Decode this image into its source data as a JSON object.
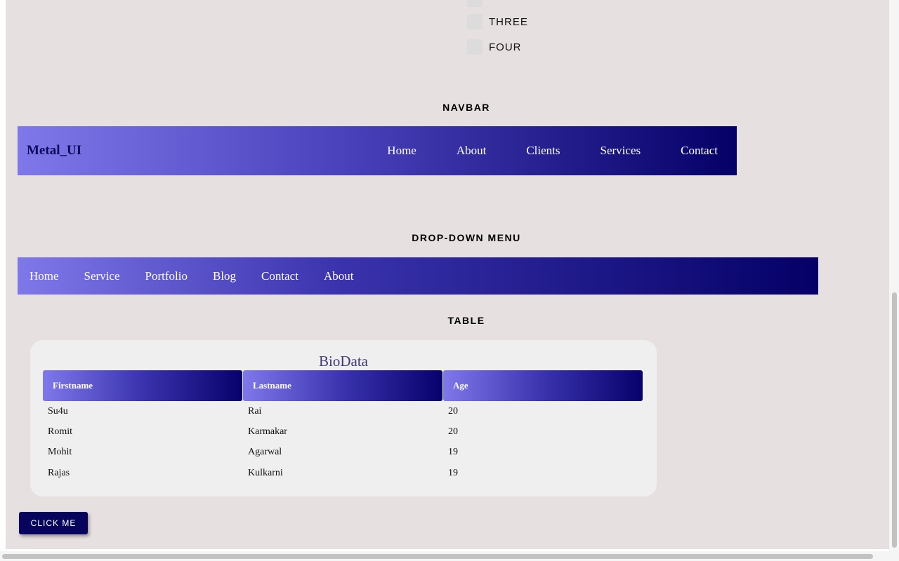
{
  "checklist": {
    "items": [
      "THREE",
      "FOUR"
    ]
  },
  "navbar_section": {
    "title": "NAVBAR",
    "brand": "Metal_UI",
    "links": [
      "Home",
      "About",
      "Clients",
      "Services",
      "Contact"
    ]
  },
  "dropdown_section": {
    "title": "DROP-DOWN MENU",
    "items": [
      "Home",
      "Service",
      "Portfolio",
      "Blog",
      "Contact",
      "About"
    ]
  },
  "table_section": {
    "title": "TABLE",
    "caption": "BioData",
    "headers": [
      "Firstname",
      "Lastname",
      "Age"
    ],
    "rows": [
      [
        "Su4u",
        "Rai",
        "20"
      ],
      [
        "Romit",
        "Karmakar",
        "20"
      ],
      [
        "Mohit",
        "Agarwal",
        "19"
      ],
      [
        "Rajas",
        "Kulkarni",
        "19"
      ]
    ]
  },
  "button": {
    "label": "CLICK ME"
  },
  "colors": {
    "page_background": "#e7e0e1",
    "gradient_start": "#7f78ea",
    "gradient_end": "#040067",
    "button": "#06045d"
  }
}
